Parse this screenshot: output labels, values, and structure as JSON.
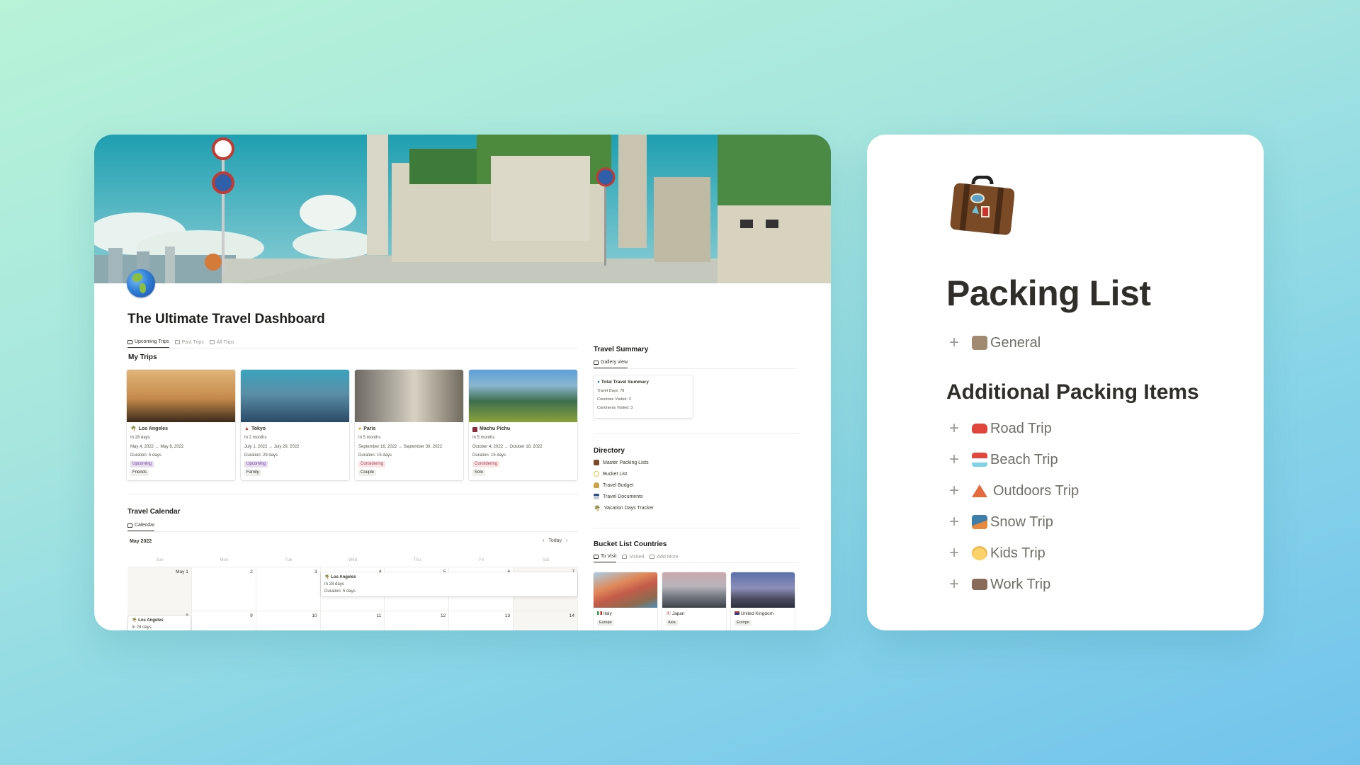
{
  "background": {
    "gradient_from": "#b8f3d8",
    "gradient_to": "#72c3ec"
  },
  "dashboard": {
    "title": "The Ultimate Travel Dashboard",
    "page_icon": "globe-americas-icon",
    "trips_tabs": [
      {
        "label": "Upcoming Trips",
        "active": true
      },
      {
        "label": "Past Trips",
        "active": false
      },
      {
        "label": "All Trips",
        "active": false
      }
    ],
    "my_trips_heading": "My Trips",
    "trips": [
      {
        "name": "Los Angeles",
        "icon": "palm-tree-icon",
        "relative": "In 28 days",
        "dates": "May 4, 2022 → May 8, 2022",
        "duration": "Duration: 5 days",
        "status": "Upcoming",
        "companion": "Friends"
      },
      {
        "name": "Tokyo",
        "icon": "tokyo-tower-icon",
        "relative": "In 2 months",
        "dates": "July 1, 2022 → July 29, 2022",
        "duration": "Duration: 29 days",
        "status": "Upcoming",
        "companion": "Family"
      },
      {
        "name": "Paris",
        "icon": "croissant-icon",
        "relative": "In 5 months",
        "dates": "September 16, 2022 → September 30, 2022",
        "duration": "Duration: 15 days",
        "status": "Considering",
        "companion": "Couple"
      },
      {
        "name": "Machu Pichu",
        "icon": "sunset-icon",
        "relative": "In 5 months",
        "dates": "October 4, 2022 → October 18, 2022",
        "duration": "Duration: 15 days",
        "status": "Considering",
        "companion": "Solo"
      }
    ],
    "travel_summary": {
      "heading": "Travel Summary",
      "tab": "Gallery view",
      "card_title": "Total Travel Summary",
      "lines": [
        "Travel Days: 78",
        "Countries Visited: 3",
        "Continents Visited: 3"
      ]
    },
    "directory": {
      "heading": "Directory",
      "items": [
        {
          "label": "Master Packing Lists",
          "icon": "luggage-icon"
        },
        {
          "label": "Bucket List",
          "icon": "lasso-icon"
        },
        {
          "label": "Travel Budget",
          "icon": "money-bag-icon"
        },
        {
          "label": "Travel Documents",
          "icon": "id-card-icon"
        },
        {
          "label": "Vacation Days Tracker",
          "icon": "palm-tree-icon"
        }
      ]
    },
    "calendar": {
      "heading": "Travel Calendar",
      "tab": "Calendar",
      "month": "May 2022",
      "today_label": "Today",
      "prev_label": "‹",
      "next_label": "›",
      "weekdays": [
        "Sun",
        "Mon",
        "Tue",
        "Wed",
        "Thu",
        "Fri",
        "Sat"
      ],
      "weeks": [
        [
          "May 1",
          "2",
          "3",
          "4",
          "5",
          "6",
          "7"
        ],
        [
          "8",
          "9",
          "10",
          "11",
          "12",
          "13",
          "14"
        ]
      ],
      "events": [
        {
          "name": "Los Angeles",
          "line1": "In 28 days",
          "line2": "Duration: 5 days"
        },
        {
          "name": "Los Angeles",
          "line1": "In 28 days"
        }
      ]
    },
    "bucket_list": {
      "heading": "Bucket List Countries",
      "tabs": [
        {
          "label": "To Visit",
          "active": true
        },
        {
          "label": "Visited",
          "active": false
        },
        {
          "label": "Add More",
          "active": false
        }
      ],
      "countries": [
        {
          "name": "Italy",
          "flag": "italy-flag-icon",
          "continent": "Europe"
        },
        {
          "name": "Japan",
          "flag": "japan-flag-icon",
          "continent": "Asia"
        },
        {
          "name": "United Kingdom",
          "flag": "uk-flag-icon",
          "continent": "Europe"
        }
      ]
    }
  },
  "packing": {
    "title": "Packing List",
    "page_icon": "suitcase-icon",
    "general": {
      "label": "General",
      "icon": "luggage-icon"
    },
    "additional_heading": "Additional Packing Items",
    "items": [
      {
        "label": "Road Trip",
        "icon": "car-icon"
      },
      {
        "label": "Beach Trip",
        "icon": "beach-umbrella-icon"
      },
      {
        "label": "Outdoors Trip",
        "icon": "tent-icon"
      },
      {
        "label": "Snow Trip",
        "icon": "snowboarder-icon"
      },
      {
        "label": "Kids Trip",
        "icon": "child-icon"
      },
      {
        "label": "Work Trip",
        "icon": "briefcase-icon"
      }
    ]
  }
}
